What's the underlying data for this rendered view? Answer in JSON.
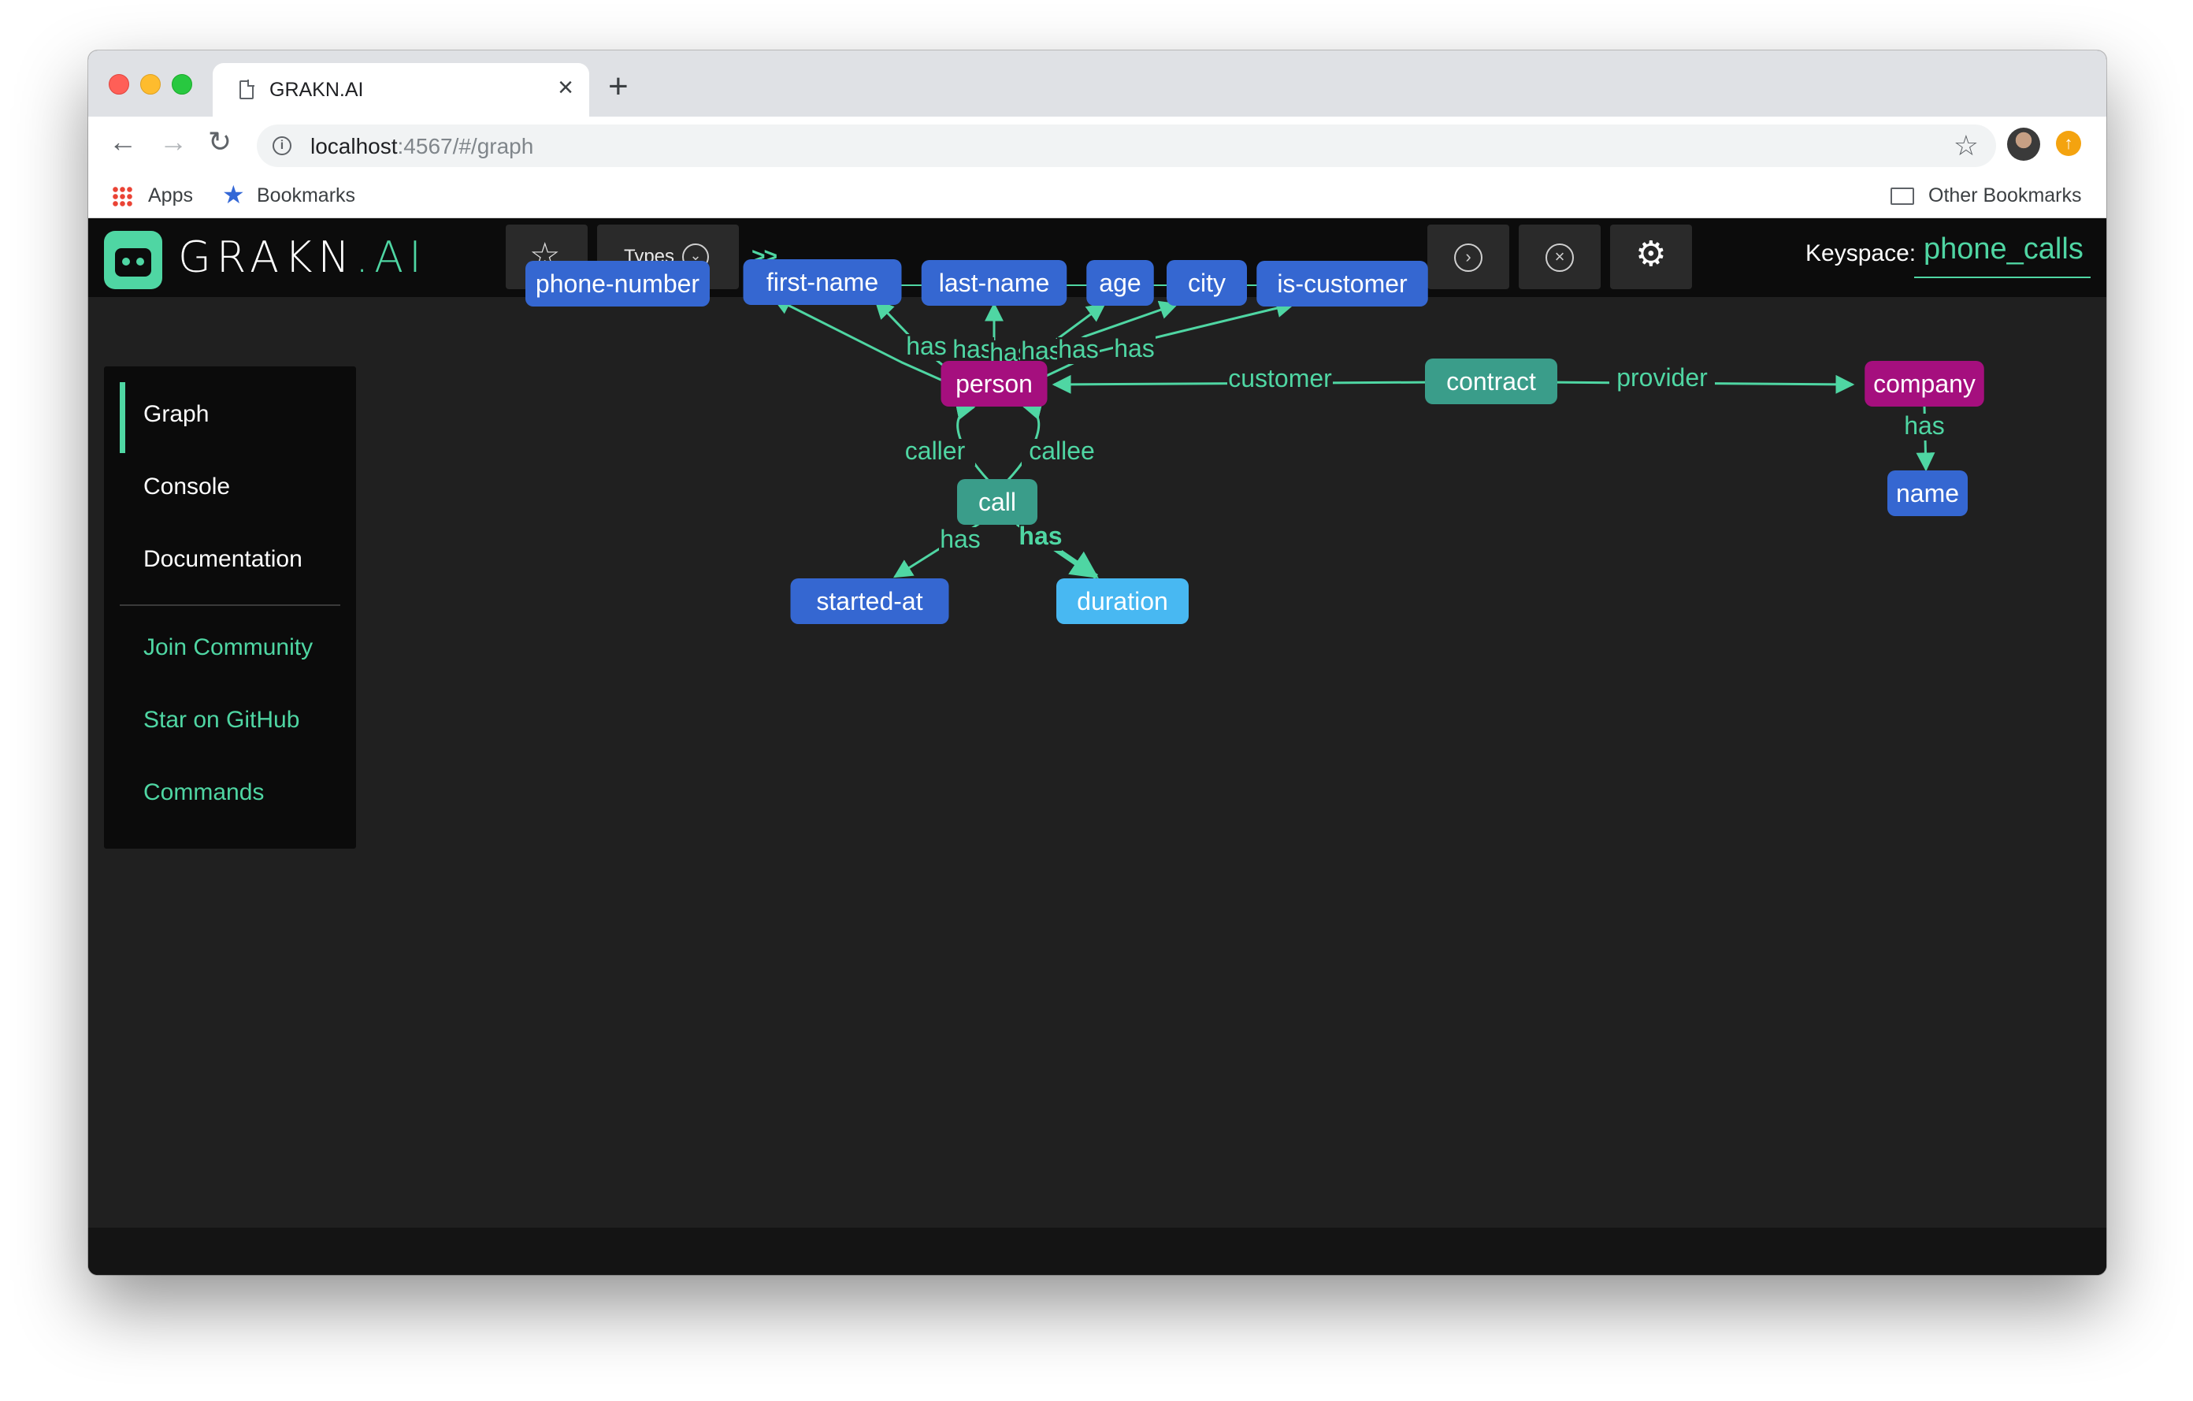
{
  "browser": {
    "tab_title": "GRAKN.AI",
    "tab_close": "×",
    "new_tab": "+",
    "url_host": "localhost",
    "url_path": ":4567/#/graph",
    "bookmarks": {
      "apps": "Apps",
      "bookmarks": "Bookmarks",
      "other": "Other Bookmarks"
    }
  },
  "app": {
    "logo_main": "GRAKN",
    "logo_ai": ".AI",
    "types_label": "Types",
    "query_prompt": ">>",
    "keyspace_label": "Keyspace:",
    "keyspace_value": "phone_calls"
  },
  "sidebar": {
    "items": [
      {
        "label": "Graph",
        "active": true
      },
      {
        "label": "Console"
      },
      {
        "label": "Documentation"
      }
    ],
    "links": [
      {
        "label": "Join Community"
      },
      {
        "label": "Star on GitHub"
      },
      {
        "label": "Commands"
      }
    ]
  },
  "graph": {
    "colors": {
      "attribute": "#3567d1",
      "attribute_selected": "#48b8f2",
      "entity": "#a50f7e",
      "relation": "#3a9d8a",
      "edge": "#4fd6a3"
    },
    "nodes": [
      {
        "id": "phone-number",
        "label": "phone-number",
        "kind": "attribute"
      },
      {
        "id": "first-name",
        "label": "first-name",
        "kind": "attribute"
      },
      {
        "id": "last-name",
        "label": "last-name",
        "kind": "attribute"
      },
      {
        "id": "age",
        "label": "age",
        "kind": "attribute"
      },
      {
        "id": "city",
        "label": "city",
        "kind": "attribute"
      },
      {
        "id": "is-customer",
        "label": "is-customer",
        "kind": "attribute"
      },
      {
        "id": "person",
        "label": "person",
        "kind": "entity"
      },
      {
        "id": "contract",
        "label": "contract",
        "kind": "relation"
      },
      {
        "id": "company",
        "label": "company",
        "kind": "entity"
      },
      {
        "id": "name",
        "label": "name",
        "kind": "attribute"
      },
      {
        "id": "call",
        "label": "call",
        "kind": "relation"
      },
      {
        "id": "started-at",
        "label": "started-at",
        "kind": "attribute"
      },
      {
        "id": "duration",
        "label": "duration",
        "kind": "attribute_selected"
      }
    ],
    "edges": [
      {
        "from": "person",
        "to": "phone-number",
        "label": "has"
      },
      {
        "from": "person",
        "to": "first-name",
        "label": "has"
      },
      {
        "from": "person",
        "to": "last-name",
        "label": "has"
      },
      {
        "from": "person",
        "to": "age",
        "label": "has"
      },
      {
        "from": "person",
        "to": "city",
        "label": "has"
      },
      {
        "from": "person",
        "to": "is-customer",
        "label": "has"
      },
      {
        "from": "contract",
        "to": "person",
        "label": "customer"
      },
      {
        "from": "contract",
        "to": "company",
        "label": "provider"
      },
      {
        "from": "company",
        "to": "name",
        "label": "has"
      },
      {
        "from": "call",
        "to": "person",
        "label": "caller"
      },
      {
        "from": "call",
        "to": "person",
        "label": "callee"
      },
      {
        "from": "call",
        "to": "started-at",
        "label": "has"
      },
      {
        "from": "call",
        "to": "duration",
        "label": "has",
        "bold": true
      }
    ]
  }
}
